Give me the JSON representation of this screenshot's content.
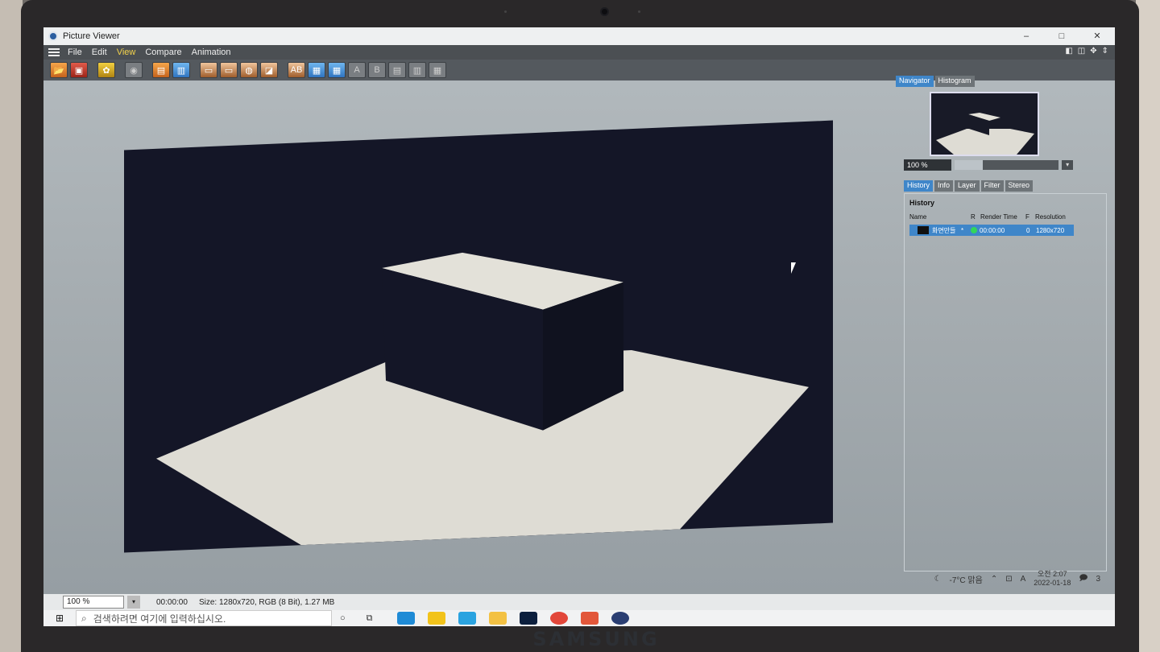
{
  "window": {
    "title": "Picture Viewer",
    "controls": [
      "–",
      "□",
      "✕"
    ]
  },
  "menu": [
    "File",
    "Edit",
    "View",
    "Compare",
    "Animation"
  ],
  "menu_active": "View",
  "toolbar": {
    "buttons": [
      "open-file",
      "save",
      "render",
      "stop",
      "layer",
      "layer-list",
      "frame-1",
      "frame-2",
      "frame-3",
      "frame-4",
      "compare-ab",
      "show-a",
      "show-b",
      "split-1",
      "split-2",
      "split-3"
    ]
  },
  "panel": {
    "top_tabs": [
      "Navigator",
      "Histogram"
    ],
    "zoom": "100 %",
    "zoom_fill_fraction": 0.27,
    "bottom_tabs": [
      "History",
      "Info",
      "Layer",
      "Filter",
      "Stereo"
    ],
    "history": {
      "title": "History",
      "columns": [
        "Name",
        "R",
        "Render Time",
        "F",
        "Resolution"
      ],
      "row": {
        "name": "화면만들",
        "marker": "*",
        "render_time": "00:00:00",
        "f": "0",
        "resolution": "1280x720"
      }
    }
  },
  "statusbar": {
    "zoom": "100 %",
    "time": "00:00:00",
    "info": "Size: 1280x720, RGB (8 Bit), 1.27 MB"
  },
  "taskbar": {
    "search_placeholder": "검색하려면 여기에 입력하십시오.",
    "weather": "-7°C 맑음",
    "input_lang": "A",
    "time": "오전 2:07",
    "date": "2022-01-18",
    "notifications": "3"
  },
  "device": {
    "brand": "SAMSUNG"
  }
}
